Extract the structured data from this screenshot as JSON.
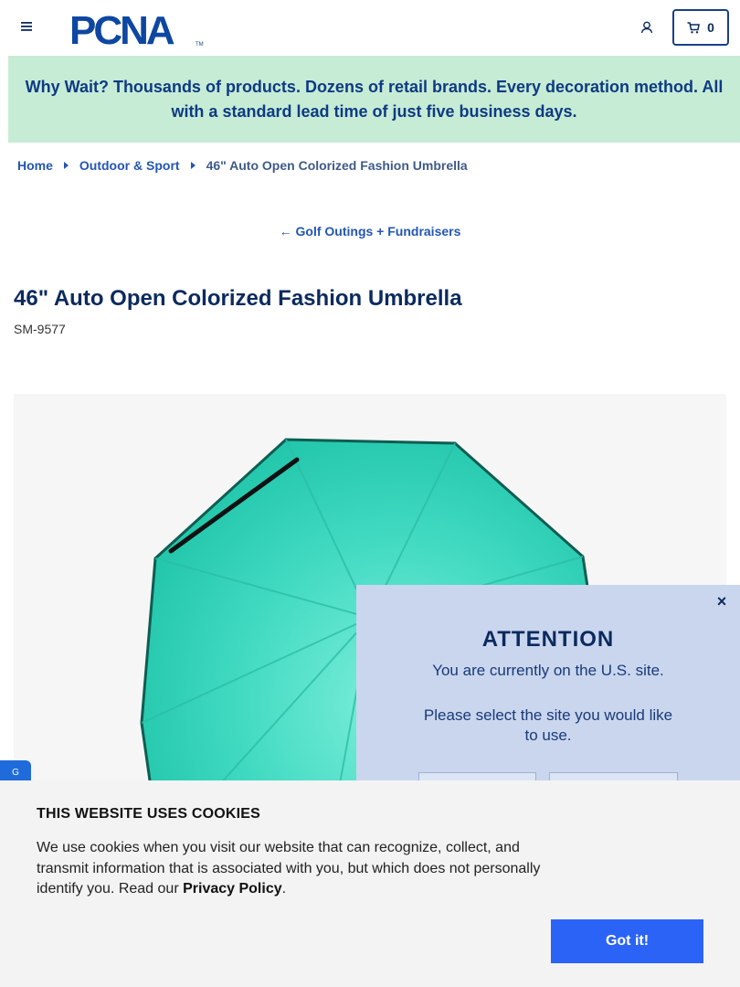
{
  "header": {
    "logo_text": "PCNA",
    "cart_count": "0"
  },
  "promo": {
    "text": "Why Wait? Thousands of products. Dozens of retail brands. Every decoration method. All with a standard lead time of just five business days."
  },
  "breadcrumb": {
    "items": [
      "Home",
      "Outdoor & Sport"
    ],
    "current": "46\" Auto Open Colorized Fashion Umbrella"
  },
  "back_link": {
    "arrow": "←",
    "label": "Golf Outings + Fundraisers"
  },
  "product": {
    "title": "46\" Auto Open Colorized Fashion Umbrella",
    "sku": "SM-9577",
    "image_color": "#3fd9c0"
  },
  "side_tab": {
    "label": "G"
  },
  "attention_modal": {
    "close": "×",
    "title": "ATTENTION",
    "message": "You are currently on the U.S. site.",
    "prompt": "Please select the site you would like to use."
  },
  "cookie_banner": {
    "title": "THIS WEBSITE USES COOKIES",
    "text": "We use cookies when you visit our website that can recognize, collect, and transmit information that is associated with you, but which does not personally identify you. Read our ",
    "link": "Privacy Policy",
    "period": ".",
    "button": "Got it!"
  },
  "colors": {
    "brand_navy": "#0d2a5c",
    "link_blue": "#2356b3",
    "promo_bg": "#c6ecd6",
    "modal_bg": "#c9d6ee",
    "cookie_button": "#2a63f5"
  }
}
